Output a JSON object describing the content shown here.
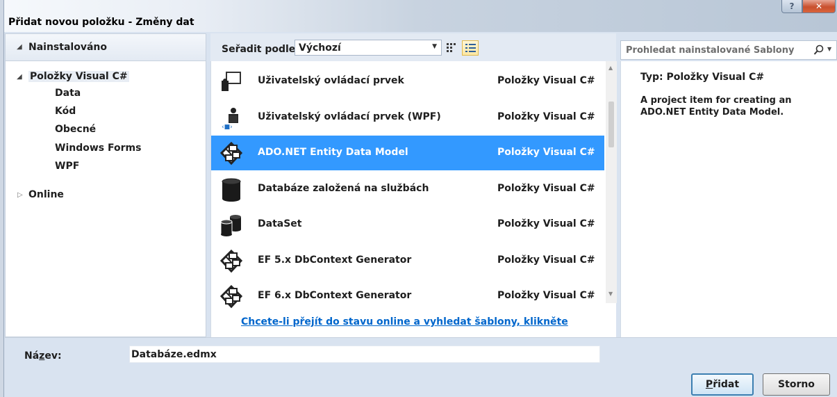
{
  "window": {
    "title": "Přidat novou položku - Změny dat",
    "help_glyph": "?",
    "close_glyph": "✕"
  },
  "tree": {
    "header": "Nainstalováno",
    "root": "Položky Visual C#",
    "children": [
      "Data",
      "Kód",
      "Obecné",
      "Windows Forms",
      "WPF"
    ],
    "online": "Online"
  },
  "toolbar": {
    "sort_label": "Seřadit podle:",
    "sort_value": "Výchozí"
  },
  "items": [
    {
      "name": "Uživatelský ovládací prvek",
      "category": "Položky Visual C#",
      "icon": "user-control-icon"
    },
    {
      "name": "Uživatelský ovládací prvek (WPF)",
      "category": "Položky Visual C#",
      "icon": "wpf-user-control-icon"
    },
    {
      "name": "ADO.NET Entity Data Model",
      "category": "Položky Visual C#",
      "icon": "entity-model-icon",
      "selected": true
    },
    {
      "name": "Databáze založená na službách",
      "category": "Položky Visual C#",
      "icon": "database-icon"
    },
    {
      "name": "DataSet",
      "category": "Položky Visual C#",
      "icon": "dataset-icon"
    },
    {
      "name": "EF 5.x DbContext Generator",
      "category": "Položky Visual C#",
      "icon": "entity-model-icon"
    },
    {
      "name": "EF 6.x DbContext Generator",
      "category": "Položky Visual C#",
      "icon": "entity-model-icon"
    }
  ],
  "online_link": "Chcete-li přejít do stavu online a vyhledat šablony, klikněte",
  "search": {
    "placeholder": "Prohledat nainstalované Šablony"
  },
  "detail": {
    "type_line": "Typ:  Položky Visual C#",
    "description": "A project item for creating an ADO.NET Entity Data Model."
  },
  "bottom": {
    "name_label_pre": "Ná",
    "name_label_accel": "z",
    "name_label_post": "ev:",
    "name_value": "Databáze.edmx",
    "add_accel": "P",
    "add_rest": "řidat",
    "cancel_label": "Storno"
  }
}
